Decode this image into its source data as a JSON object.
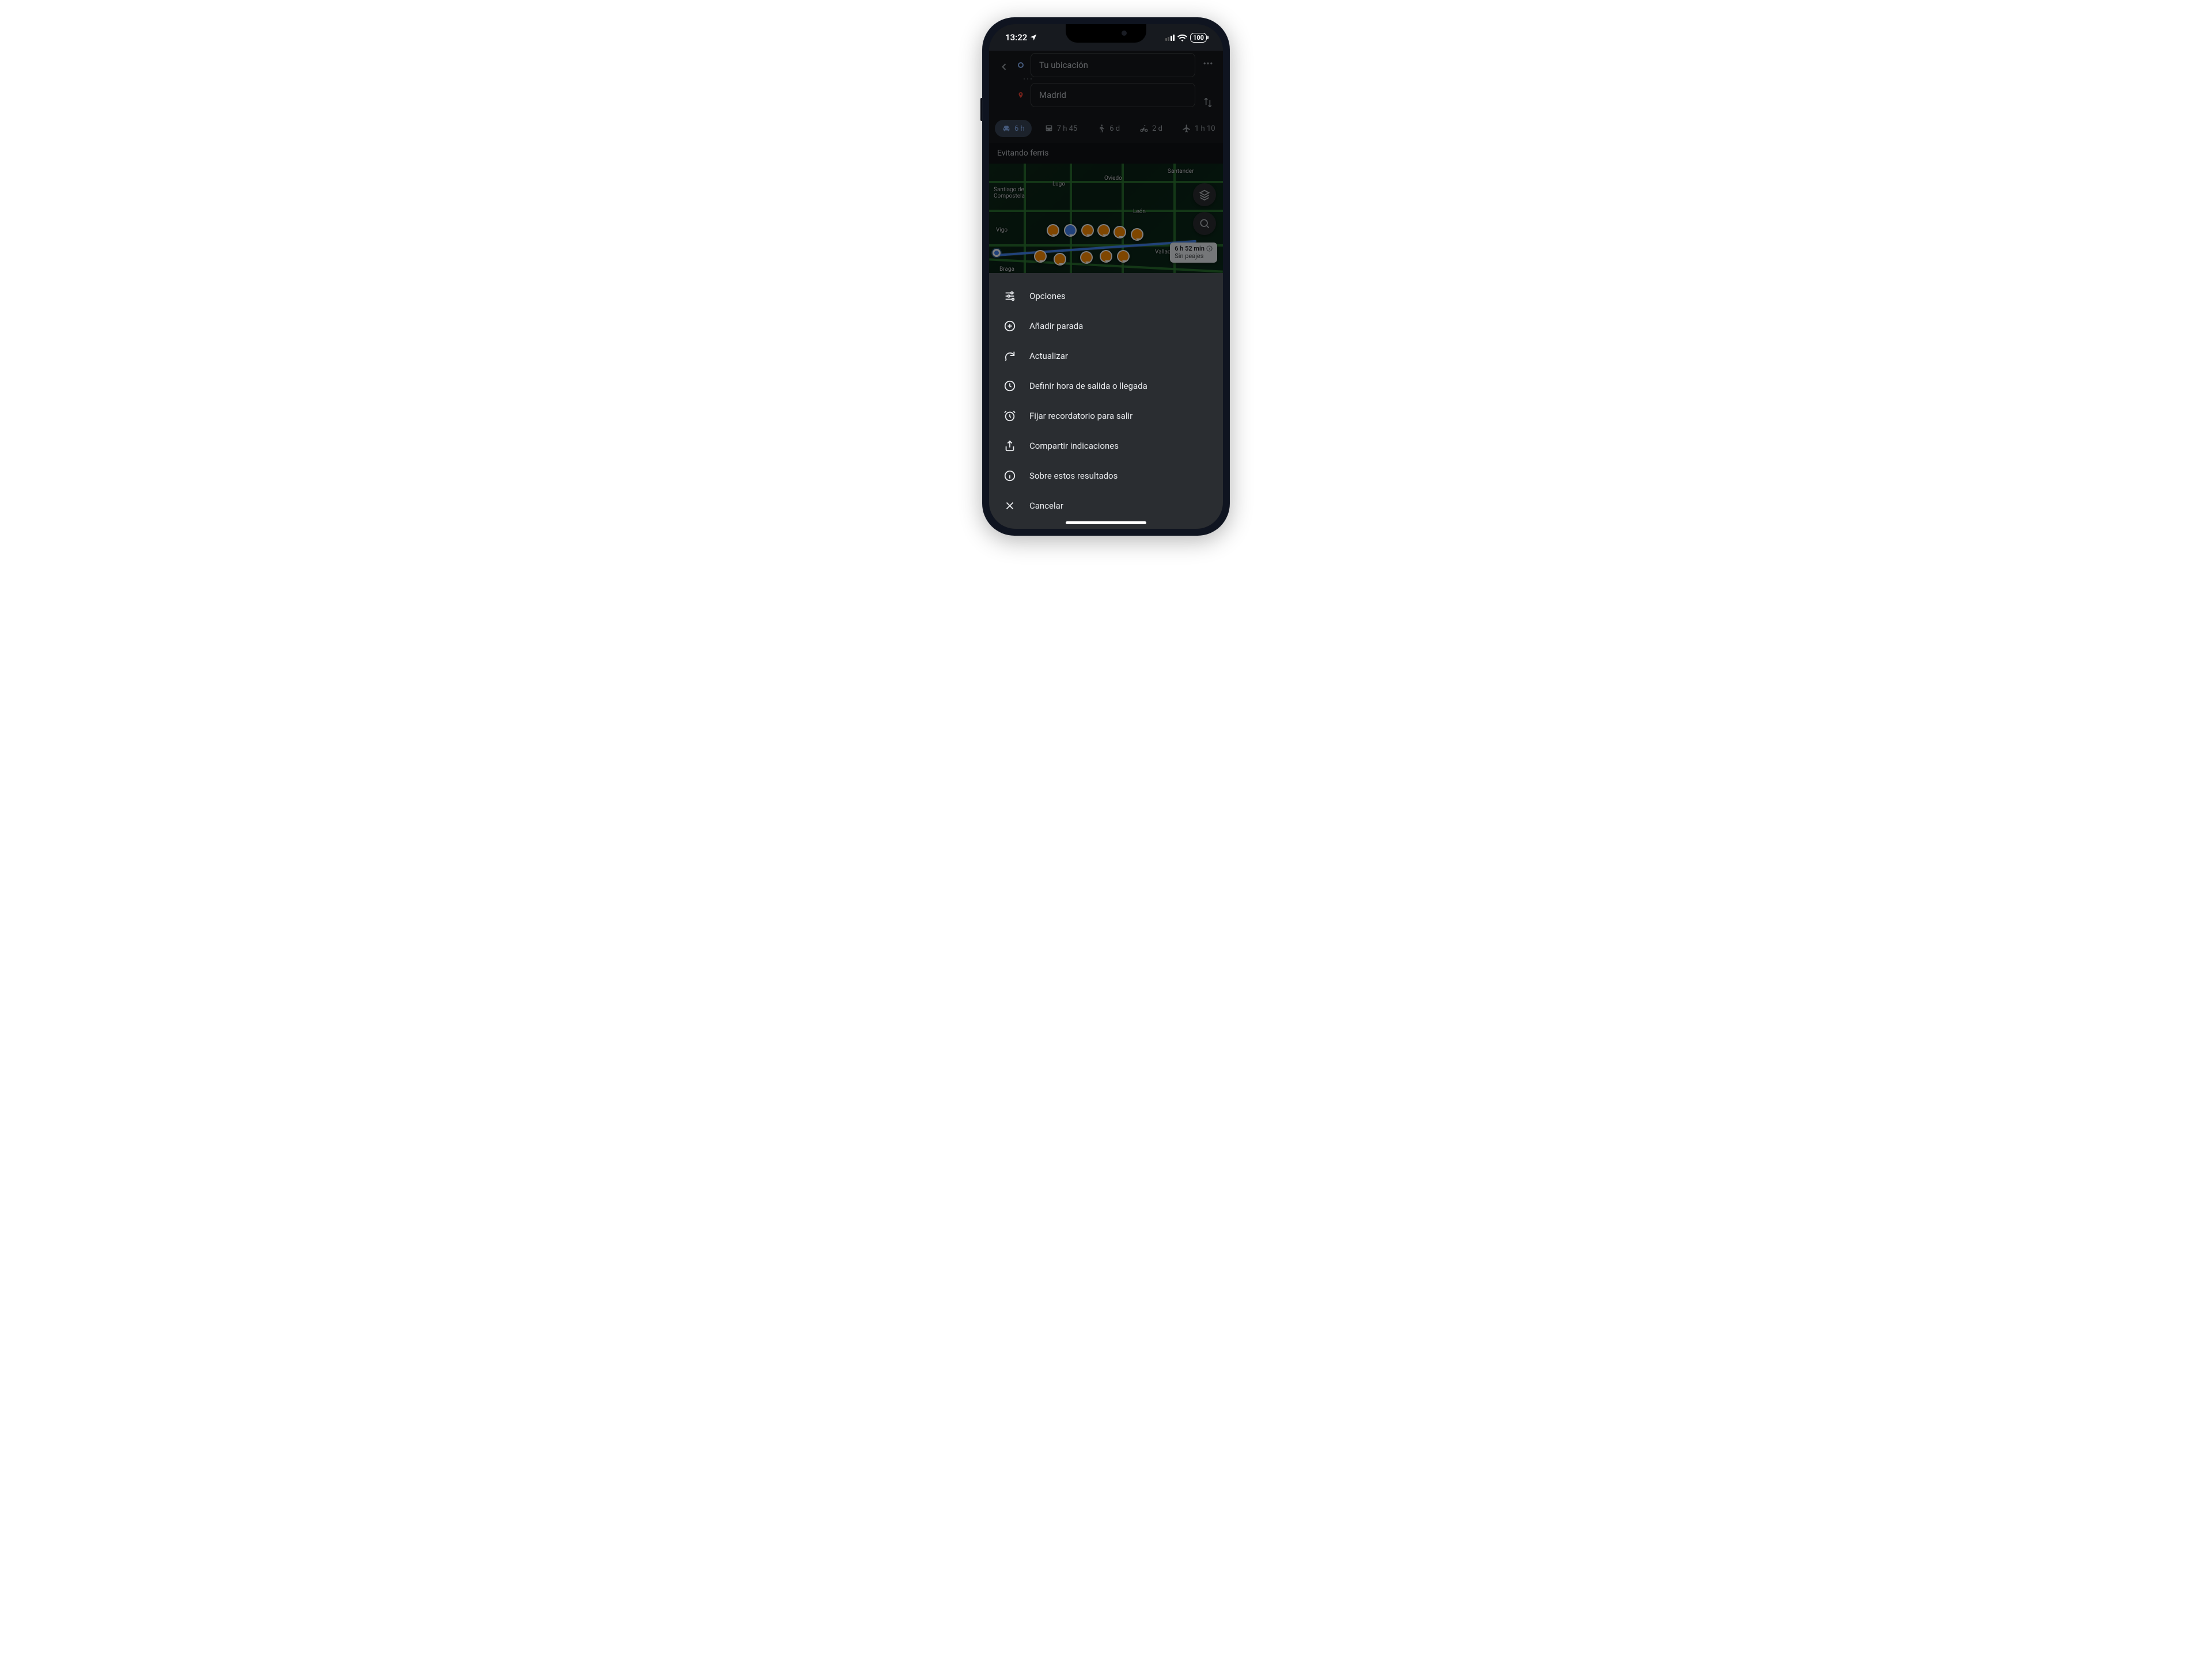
{
  "status": {
    "time": "13:22",
    "battery": "100"
  },
  "route": {
    "origin": "Tu ubicación",
    "destination": "Madrid"
  },
  "modes": {
    "car": "6 h",
    "transit": "7 h 45",
    "walk": "6 d",
    "bike": "2 d",
    "flight": "1 h 10"
  },
  "avoid_banner": "Evitando ferris",
  "map": {
    "cities": {
      "santiago": "Santiago de\nCompostela",
      "lugo": "Lugo",
      "oviedo": "Oviedo",
      "santander": "Santander",
      "leon": "León",
      "vigo": "Vigo",
      "braga": "Braga",
      "valladolid": "Vallad"
    },
    "callout": {
      "time": "6 h 52 min",
      "sub": "Sin peajes"
    }
  },
  "sheet": {
    "options": "Opciones",
    "add_stop": "Añadir parada",
    "refresh": "Actualizar",
    "set_time": "Definir hora de salida o llegada",
    "reminder": "Fijar recordatorio para salir",
    "share": "Compartir indicaciones",
    "about": "Sobre estos resultados",
    "cancel": "Cancelar"
  }
}
